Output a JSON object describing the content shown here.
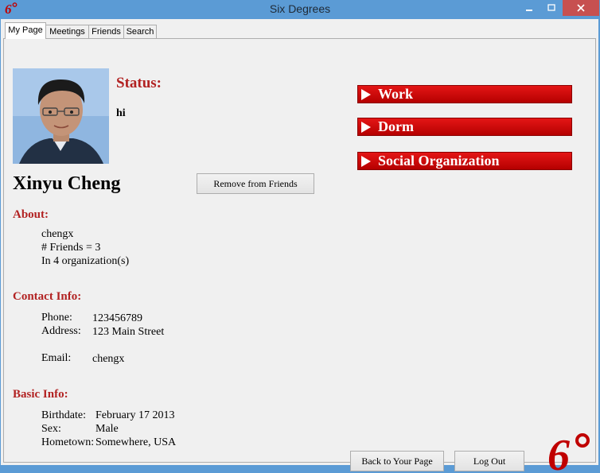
{
  "window": {
    "title": "Six Degrees"
  },
  "tabs": [
    {
      "label": "My Page",
      "active": true
    },
    {
      "label": "Meetings",
      "active": false
    },
    {
      "label": "Friends",
      "active": false
    },
    {
      "label": "Search",
      "active": false
    }
  ],
  "profile": {
    "status_label": "Status:",
    "status_value": "hi",
    "name": "Xinyu Cheng",
    "remove_button": "Remove from Friends"
  },
  "about": {
    "label": "About:",
    "username": "chengx",
    "friends": "# Friends = 3",
    "organizations": "In 4 organization(s)"
  },
  "contact": {
    "label": "Contact Info:",
    "phone_label": "Phone:",
    "phone": "123456789",
    "address_label": "Address:",
    "address": "123 Main Street",
    "email_label": "Email:",
    "email": "chengx"
  },
  "basic": {
    "label": "Basic Info:",
    "birthdate_label": "Birthdate:",
    "birthdate": "February 17 2013",
    "sex_label": "Sex:",
    "sex": "Male",
    "hometown_label": "Hometown:",
    "hometown": "Somewhere, USA"
  },
  "groups": [
    {
      "label": "Work"
    },
    {
      "label": "Dorm"
    },
    {
      "label": "Social Organization"
    }
  ],
  "footer": {
    "back_button": "Back to Your Page",
    "logout_button": "Log Out"
  },
  "colors": {
    "accent_red": "#b22222",
    "button_red": "#d40000",
    "titlebar": "#5b9bd5"
  }
}
